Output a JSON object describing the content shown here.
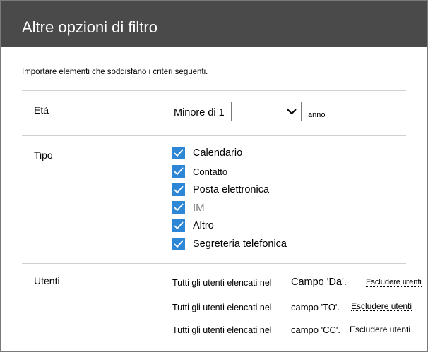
{
  "dialog": {
    "title": "Altre opzioni di filtro",
    "intro": "Importare elementi che soddisfano i criteri seguenti."
  },
  "age": {
    "label": "Età",
    "prefix": "Minore di 1",
    "selected_value": "",
    "suffix": "anno"
  },
  "type": {
    "label": "Tipo",
    "items": [
      {
        "label": "Calendario",
        "checked": true
      },
      {
        "label": "Contatto",
        "checked": true
      },
      {
        "label": "Posta elettronica",
        "checked": true
      },
      {
        "label": "IM",
        "checked": true
      },
      {
        "label": "Altro",
        "checked": true
      },
      {
        "label": "Segreteria telefonica",
        "checked": true
      }
    ]
  },
  "users": {
    "label": "Utenti",
    "rows": [
      {
        "prefix": "Tutti gli utenti elencati nel",
        "field": "Campo 'Da'.",
        "action": "Escludere utenti"
      },
      {
        "prefix": "Tutti gli utenti elencati nel",
        "field": "campo 'TO'.",
        "action": "Escludere utenti"
      },
      {
        "prefix": "Tutti gli utenti elencati nel",
        "field": "campo 'CC'.",
        "action": "Escludere utenti"
      }
    ]
  },
  "colors": {
    "titlebar": "#4a4a4a",
    "checkbox": "#2e86d6"
  }
}
